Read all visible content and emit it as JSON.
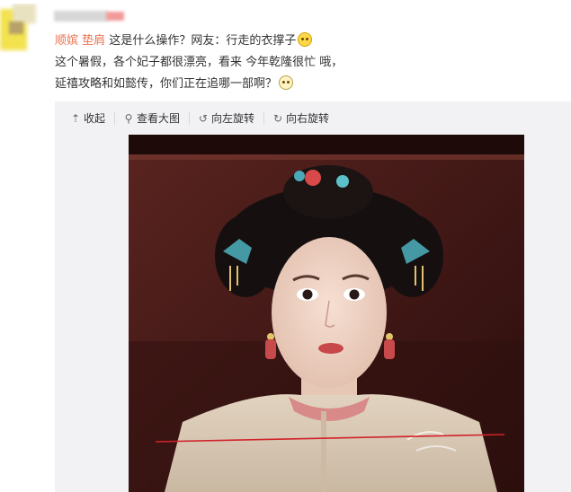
{
  "post": {
    "mention_1": "顺嫔",
    "mention_2": "垫肩",
    "line1_text": "这是什么操作？网友：行走的衣撑子",
    "line2": "这个暑假，各个妃子都很漂亮，看来 今年乾隆很忙 哦，",
    "line3": "延禧攻略和如懿传，你们正在追哪一部啊？"
  },
  "toolbar": {
    "collapse_label": "收起",
    "view_large_label": "查看大图",
    "rotate_left_label": "向左旋转",
    "rotate_right_label": "向右旋转",
    "icons": [
      "collapse-arrow-icon",
      "magnifier-icon",
      "rotate-left-icon",
      "rotate-right-icon"
    ]
  },
  "colors": {
    "mention": "#eb7350",
    "panel_bg": "#f2f2f5",
    "annotation_line": "#d2222a"
  }
}
